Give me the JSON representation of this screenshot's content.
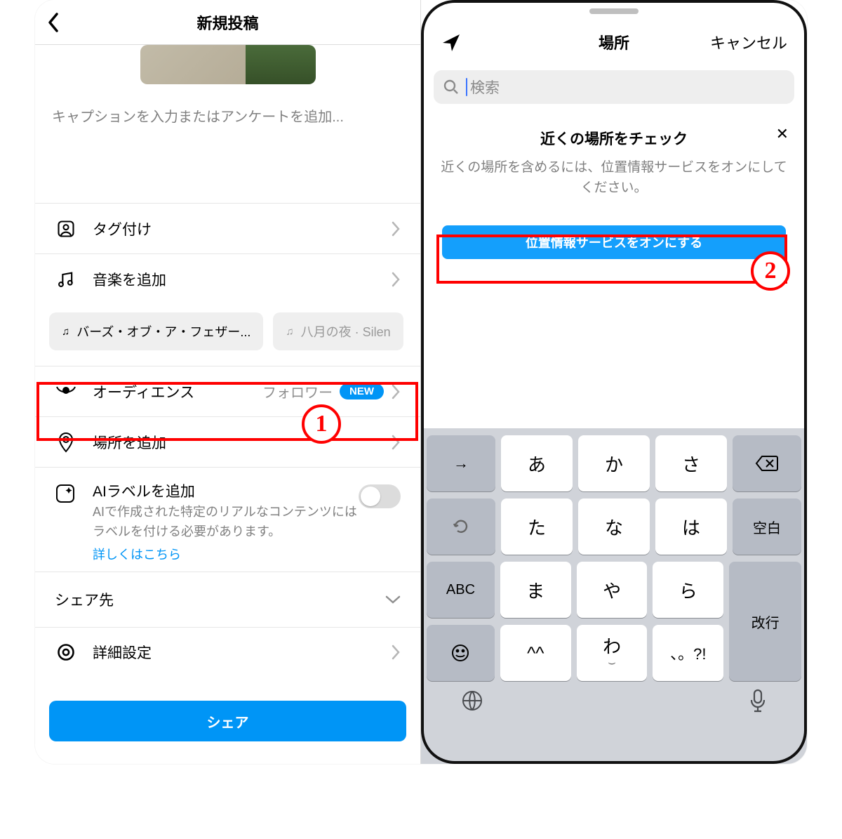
{
  "left": {
    "header_title": "新規投稿",
    "caption_placeholder": "キャプションを入力またはアンケートを追加...",
    "rows": {
      "tag": "タグ付け",
      "music": "音楽を追加",
      "audience": "オーディエンス",
      "audience_meta": "フォロワー",
      "audience_badge": "NEW",
      "location": "場所を追加",
      "advanced": "詳細設定"
    },
    "music_chips": {
      "chip1": "バーズ・オブ・ア・フェザー...",
      "chip2": "八月の夜 · Silen"
    },
    "ai": {
      "title": "AIラベルを追加",
      "desc": "AIで作成された特定のリアルなコンテンツにはラベルを付ける必要があります。",
      "link": "詳しくはこちら"
    },
    "share_section": "シェア先",
    "share_button": "シェア",
    "annotation1": "1"
  },
  "right": {
    "header_title": "場所",
    "cancel": "キャンセル",
    "search_placeholder": "検索",
    "info_title": "近くの場所をチェック",
    "info_desc": "近くの場所を含めるには、位置情報サービスをオンにしてください。",
    "enable_button": "位置情報サービスをオンにする",
    "annotation2": "2",
    "keyboard": {
      "row1": [
        "→",
        "あ",
        "か",
        "さ",
        "⌫"
      ],
      "row2": [
        "↺",
        "た",
        "な",
        "は",
        "空白"
      ],
      "row3": [
        "ABC",
        "ま",
        "や",
        "ら"
      ],
      "row4": [
        "☺",
        "^^",
        "わ",
        "、。?!"
      ],
      "tall": "改行"
    }
  }
}
